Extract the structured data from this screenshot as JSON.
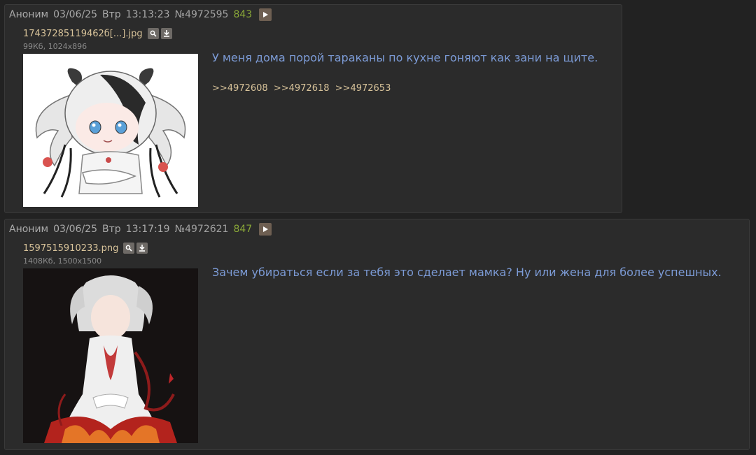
{
  "posts": [
    {
      "author": "Аноним",
      "date": "03/06/25",
      "day": "Втр",
      "time": "13:13:23",
      "number": "№4972595",
      "counter": "843",
      "file": {
        "name": "17437285119462б[...].jpg",
        "meta": "99Кб, 1024x896"
      },
      "message": "У меня дома порой тараканы по кухне гоняют как зани на щите.",
      "replies": [
        ">>4972608",
        ">>4972618",
        ">>4972653"
      ]
    },
    {
      "author": "Аноним",
      "date": "03/06/25",
      "day": "Втр",
      "time": "13:17:19",
      "number": "№4972621",
      "counter": "847",
      "file": {
        "name": "1597515910233.png",
        "meta": "1408Кб, 1500x1500"
      },
      "message": "Зачем убираться если за тебя это сделает мамка? Ну или жена для более успешных."
    }
  ],
  "icons": {
    "play": "play-icon",
    "search": "search-icon",
    "download": "download-icon"
  },
  "colors": {
    "background": "#222222",
    "post_background": "#2b2b2b",
    "message_text": "#7c9bd6",
    "reply_link": "#d8c39a",
    "counter": "#8aa838"
  }
}
